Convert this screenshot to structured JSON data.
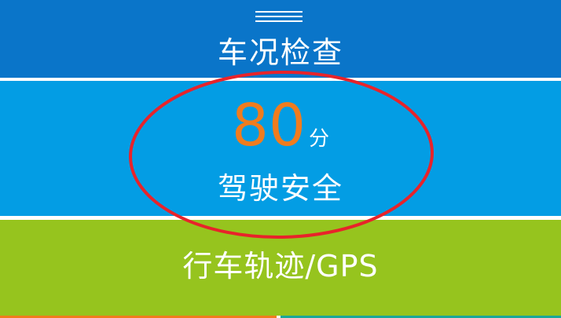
{
  "header": {
    "menu_icon": "hamburger-menu-icon"
  },
  "vehicle_check": {
    "title": "车况检查",
    "color": "#0a75c9"
  },
  "driving_score": {
    "score": "80",
    "unit": "分",
    "label": "驾驶安全",
    "color": "#039de4",
    "score_color": "#f07c1e"
  },
  "track": {
    "title": "行车轨迹/GPS",
    "color": "#96c41e"
  },
  "annotation": {
    "shape": "ellipse",
    "color": "#e8232a"
  }
}
